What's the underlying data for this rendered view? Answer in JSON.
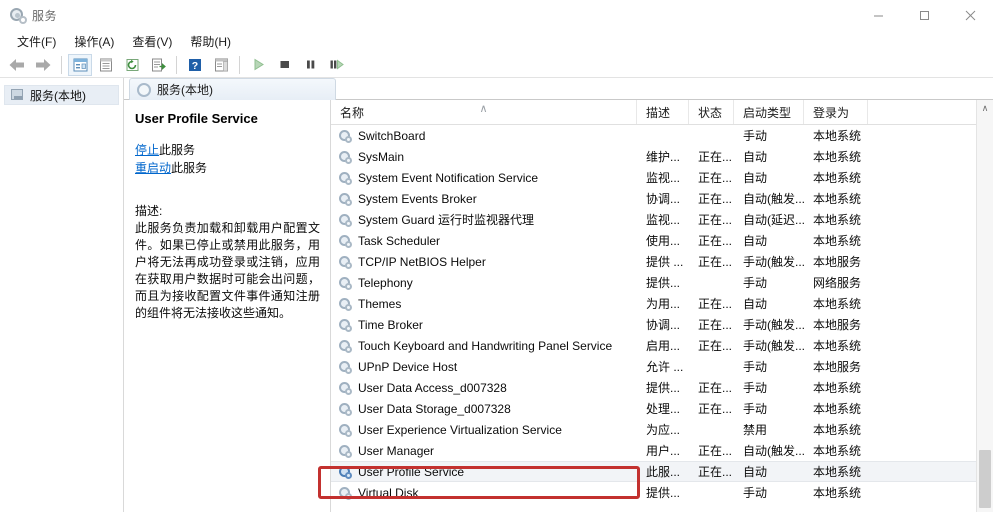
{
  "window": {
    "title": "服务",
    "icon": "services-cog-icon",
    "minimize_label": "最小化",
    "maximize_label": "最大化",
    "close_label": "关闭"
  },
  "menubar": {
    "items": [
      {
        "label": "文件(F)",
        "name": "menu-file"
      },
      {
        "label": "操作(A)",
        "name": "menu-action"
      },
      {
        "label": "查看(V)",
        "name": "menu-view"
      },
      {
        "label": "帮助(H)",
        "name": "menu-help"
      }
    ]
  },
  "toolbar": {
    "buttons": [
      {
        "name": "back-button",
        "icon": "arrow-left-icon",
        "glyph": "left-arrow"
      },
      {
        "name": "forward-button",
        "icon": "arrow-right-icon",
        "glyph": "right-arrow"
      },
      {
        "name": "show-hide-tree-button",
        "icon": "console-tree-icon",
        "glyph": "tree"
      },
      {
        "name": "properties-button",
        "icon": "properties-icon",
        "glyph": "list"
      },
      {
        "name": "refresh-button",
        "icon": "refresh-icon",
        "glyph": "refresh"
      },
      {
        "name": "export-list-button",
        "icon": "export-list-icon",
        "glyph": "export"
      },
      {
        "name": "help-button",
        "icon": "help-icon",
        "glyph": "help"
      },
      {
        "name": "show-action-pane-button",
        "icon": "action-pane-icon",
        "glyph": "pane"
      },
      {
        "name": "start-service-button",
        "icon": "play-icon",
        "glyph": "play"
      },
      {
        "name": "stop-service-button",
        "icon": "stop-icon",
        "glyph": "stop"
      },
      {
        "name": "pause-service-button",
        "icon": "pause-icon",
        "glyph": "pause"
      },
      {
        "name": "restart-service-button",
        "icon": "restart-icon",
        "glyph": "restart"
      }
    ]
  },
  "tree": {
    "root_label": "服务(本地)",
    "root_icon": "services-node-icon"
  },
  "content": {
    "tab_label": "服务(本地)",
    "tab_icon": "services-node-icon"
  },
  "detail": {
    "service_name": "User Profile Service",
    "links": [
      {
        "link_text": "停止",
        "suffix": "此服务",
        "name": "stop-service-link"
      },
      {
        "link_text": "重启动",
        "suffix": "此服务",
        "name": "restart-service-link"
      }
    ],
    "description_label": "描述:",
    "description_text": "此服务负责加载和卸载用户配置文件。如果已停止或禁用此服务，用户将无法再成功登录或注销，应用在获取用户数据时可能会出问题，而且为接收配置文件事件通知注册的组件将无法接收这些通知。"
  },
  "list": {
    "sort_indicator": "∧",
    "sorted_column": "名称",
    "columns": [
      {
        "key": "name",
        "label": "名称"
      },
      {
        "key": "desc",
        "label": "描述"
      },
      {
        "key": "state",
        "label": "状态"
      },
      {
        "key": "start",
        "label": "启动类型"
      },
      {
        "key": "logon",
        "label": "登录为"
      }
    ],
    "rows": [
      {
        "name": "SwitchBoard",
        "desc": "",
        "state": "",
        "start": "手动",
        "logon": "本地系统",
        "selected": false
      },
      {
        "name": "SysMain",
        "desc": "维护...",
        "state": "正在...",
        "start": "自动",
        "logon": "本地系统",
        "selected": false
      },
      {
        "name": "System Event Notification Service",
        "desc": "监视...",
        "state": "正在...",
        "start": "自动",
        "logon": "本地系统",
        "selected": false
      },
      {
        "name": "System Events Broker",
        "desc": "协调...",
        "state": "正在...",
        "start": "自动(触发...",
        "logon": "本地系统",
        "selected": false
      },
      {
        "name": "System Guard 运行时监视器代理",
        "desc": "监视...",
        "state": "正在...",
        "start": "自动(延迟...",
        "logon": "本地系统",
        "selected": false
      },
      {
        "name": "Task Scheduler",
        "desc": "使用...",
        "state": "正在...",
        "start": "自动",
        "logon": "本地系统",
        "selected": false
      },
      {
        "name": "TCP/IP NetBIOS Helper",
        "desc": "提供 ...",
        "state": "正在...",
        "start": "手动(触发...",
        "logon": "本地服务",
        "selected": false
      },
      {
        "name": "Telephony",
        "desc": "提供...",
        "state": "",
        "start": "手动",
        "logon": "网络服务",
        "selected": false
      },
      {
        "name": "Themes",
        "desc": "为用...",
        "state": "正在...",
        "start": "自动",
        "logon": "本地系统",
        "selected": false
      },
      {
        "name": "Time Broker",
        "desc": "协调...",
        "state": "正在...",
        "start": "手动(触发...",
        "logon": "本地服务",
        "selected": false
      },
      {
        "name": "Touch Keyboard and Handwriting Panel Service",
        "desc": "启用...",
        "state": "正在...",
        "start": "手动(触发...",
        "logon": "本地系统",
        "selected": false
      },
      {
        "name": "UPnP Device Host",
        "desc": "允许 ...",
        "state": "",
        "start": "手动",
        "logon": "本地服务",
        "selected": false
      },
      {
        "name": "User Data Access_d007328",
        "desc": "提供...",
        "state": "正在...",
        "start": "手动",
        "logon": "本地系统",
        "selected": false
      },
      {
        "name": "User Data Storage_d007328",
        "desc": "处理...",
        "state": "正在...",
        "start": "手动",
        "logon": "本地系统",
        "selected": false
      },
      {
        "name": "User Experience Virtualization Service",
        "desc": "为应...",
        "state": "",
        "start": "禁用",
        "logon": "本地系统",
        "selected": false
      },
      {
        "name": "User Manager",
        "desc": "用户...",
        "state": "正在...",
        "start": "自动(触发...",
        "logon": "本地系统",
        "selected": false
      },
      {
        "name": "User Profile Service",
        "desc": "此服...",
        "state": "正在...",
        "start": "自动",
        "logon": "本地系统",
        "selected": true
      },
      {
        "name": "Virtual Disk",
        "desc": "提供...",
        "state": "",
        "start": "手动",
        "logon": "本地系统",
        "selected": false
      }
    ]
  },
  "scrollbar": {
    "up_arrow": "∧",
    "down_arrow": "∨"
  },
  "annotation": {
    "color": "#c3312f",
    "target": "User Profile Service"
  }
}
